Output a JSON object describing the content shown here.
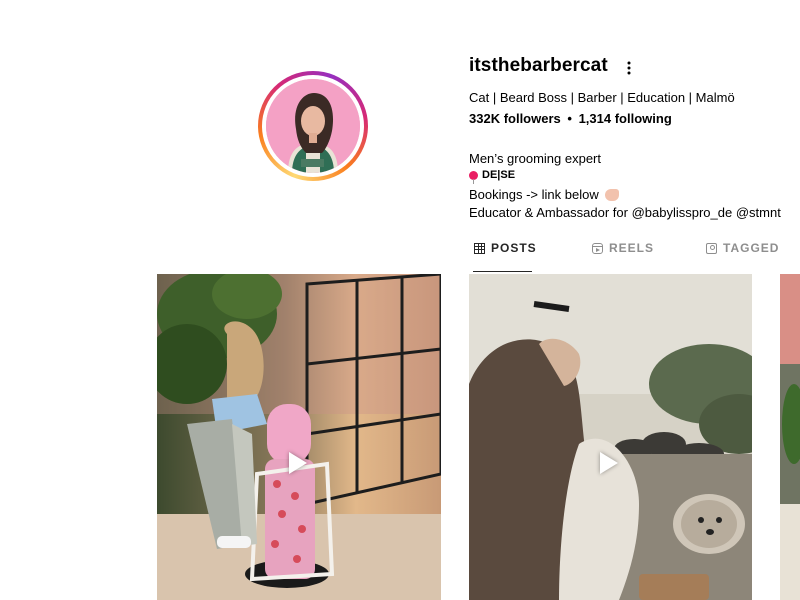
{
  "profile": {
    "username": "itsthebarbercat",
    "category": "Cat | Beard Boss | Barber | Education | Malmö",
    "followers": "332K followers",
    "following": "1,314 following",
    "separator": "•",
    "bio": {
      "line1": "Men’s grooming expert",
      "line2": "DE|SE",
      "line3": "Bookings -> link below",
      "line4": "Educator & Ambassador for @babylisspro_de @stmnt"
    }
  },
  "icons": {
    "more": "more-options-icon",
    "posts": "grid-icon",
    "reels": "reels-icon",
    "tagged": "tagged-icon",
    "location": "pin-icon",
    "hand": "pointing-down-hand-icon",
    "play": "play-icon"
  },
  "tabs": [
    {
      "label": "POSTS",
      "active": true
    },
    {
      "label": "REELS",
      "active": false
    },
    {
      "label": "TAGGED",
      "active": false
    }
  ],
  "colors": {
    "text": "#262626",
    "muted": "#8e8e8e",
    "ring_start": "#feda75",
    "ring_mid": "#d62976",
    "ring_end": "#962fbf"
  }
}
